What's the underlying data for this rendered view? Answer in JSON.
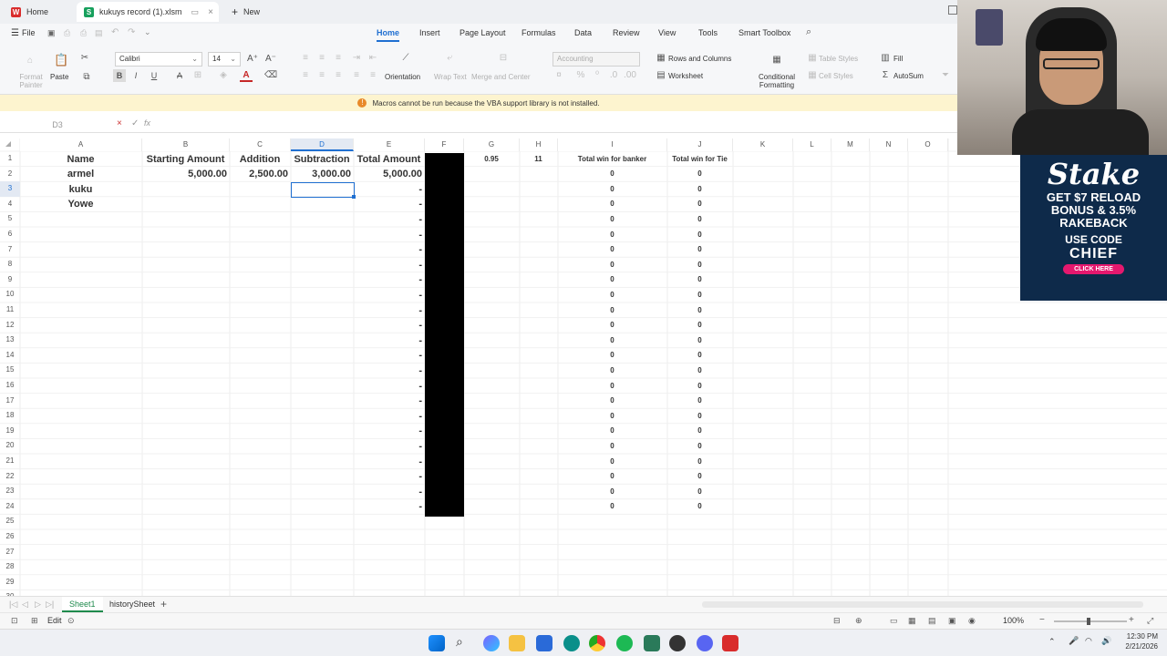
{
  "titlebar": {
    "home_tab": "Home",
    "file_tab": "kukuys record (1).xlsm",
    "new_tab": "New"
  },
  "menu": {
    "file": "File",
    "items": [
      "Home",
      "Insert",
      "Page Layout",
      "Formulas",
      "Data",
      "Review",
      "View",
      "Tools",
      "Smart Toolbox"
    ]
  },
  "ribbon": {
    "format_painter": "Format Painter",
    "paste": "Paste",
    "font_name": "Calibri",
    "font_size": "14",
    "orientation": "Orientation",
    "wrap_text": "Wrap Text",
    "merge_center": "Merge and Center",
    "number_format": "Accounting",
    "rows_columns": "Rows and Columns",
    "worksheet": "Worksheet",
    "conditional_formatting": "Conditional Formatting",
    "table_styles": "Table Styles",
    "cell_styles": "Cell Styles",
    "fill": "Fill",
    "autosum": "AutoSum"
  },
  "banner": {
    "message": "Macros cannot be run because the VBA support library is not installed."
  },
  "formula_bar": {
    "name_box": "D3",
    "fx": "fx",
    "content": ""
  },
  "columns": [
    "A",
    "B",
    "C",
    "D",
    "E",
    "F",
    "G",
    "H",
    "I",
    "J",
    "K",
    "L",
    "M",
    "N",
    "O"
  ],
  "rows_count": 31,
  "sheet": {
    "headers": {
      "A1": "Name",
      "B1": "Starting Amount",
      "C1": "Addition",
      "D1": "Subtraction",
      "E1": "Total Amount",
      "G1": "0.95",
      "H1": "11",
      "I1": "Total win for banker",
      "J1": "Total win for Tie"
    },
    "row2": {
      "A": "armel",
      "B": "5,000.00",
      "C": "2,500.00",
      "D": "3,000.00",
      "E": "5,000.00"
    },
    "names": [
      "kuku",
      "Yowe"
    ],
    "dash": "-",
    "zero": "0"
  },
  "sheet_tabs": [
    "Sheet1",
    "historySheet"
  ],
  "status": {
    "mode": "Edit",
    "zoom": "100%"
  },
  "clock": {
    "time": "12:30 PM",
    "date": "2/21/2026"
  },
  "ad": {
    "brand": "Stake",
    "line1": "GET $7 RELOAD",
    "line2": "BONUS & 3.5%",
    "line3": "RAKEBACK",
    "line4": "USE CODE",
    "code": "CHIEF",
    "cta": "CLICK HERE"
  },
  "colors": {
    "accent": "#1f6fd1",
    "banner_bg": "#fdf4cf",
    "selected_header": "#e3e9f3",
    "black_column": "#000000"
  }
}
